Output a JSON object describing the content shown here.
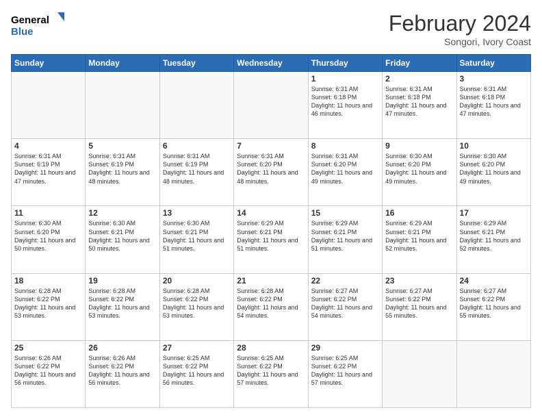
{
  "header": {
    "logo_line1": "General",
    "logo_line2": "Blue",
    "month_year": "February 2024",
    "location": "Songori, Ivory Coast"
  },
  "days_of_week": [
    "Sunday",
    "Monday",
    "Tuesday",
    "Wednesday",
    "Thursday",
    "Friday",
    "Saturday"
  ],
  "weeks": [
    [
      {
        "day": "",
        "info": ""
      },
      {
        "day": "",
        "info": ""
      },
      {
        "day": "",
        "info": ""
      },
      {
        "day": "",
        "info": ""
      },
      {
        "day": "1",
        "info": "Sunrise: 6:31 AM\nSunset: 6:18 PM\nDaylight: 11 hours and 46 minutes."
      },
      {
        "day": "2",
        "info": "Sunrise: 6:31 AM\nSunset: 6:18 PM\nDaylight: 11 hours and 47 minutes."
      },
      {
        "day": "3",
        "info": "Sunrise: 6:31 AM\nSunset: 6:18 PM\nDaylight: 11 hours and 47 minutes."
      }
    ],
    [
      {
        "day": "4",
        "info": "Sunrise: 6:31 AM\nSunset: 6:19 PM\nDaylight: 11 hours and 47 minutes."
      },
      {
        "day": "5",
        "info": "Sunrise: 6:31 AM\nSunset: 6:19 PM\nDaylight: 11 hours and 48 minutes."
      },
      {
        "day": "6",
        "info": "Sunrise: 6:31 AM\nSunset: 6:19 PM\nDaylight: 11 hours and 48 minutes."
      },
      {
        "day": "7",
        "info": "Sunrise: 6:31 AM\nSunset: 6:20 PM\nDaylight: 11 hours and 48 minutes."
      },
      {
        "day": "8",
        "info": "Sunrise: 6:31 AM\nSunset: 6:20 PM\nDaylight: 11 hours and 49 minutes."
      },
      {
        "day": "9",
        "info": "Sunrise: 6:30 AM\nSunset: 6:20 PM\nDaylight: 11 hours and 49 minutes."
      },
      {
        "day": "10",
        "info": "Sunrise: 6:30 AM\nSunset: 6:20 PM\nDaylight: 11 hours and 49 minutes."
      }
    ],
    [
      {
        "day": "11",
        "info": "Sunrise: 6:30 AM\nSunset: 6:20 PM\nDaylight: 11 hours and 50 minutes."
      },
      {
        "day": "12",
        "info": "Sunrise: 6:30 AM\nSunset: 6:21 PM\nDaylight: 11 hours and 50 minutes."
      },
      {
        "day": "13",
        "info": "Sunrise: 6:30 AM\nSunset: 6:21 PM\nDaylight: 11 hours and 51 minutes."
      },
      {
        "day": "14",
        "info": "Sunrise: 6:29 AM\nSunset: 6:21 PM\nDaylight: 11 hours and 51 minutes."
      },
      {
        "day": "15",
        "info": "Sunrise: 6:29 AM\nSunset: 6:21 PM\nDaylight: 11 hours and 51 minutes."
      },
      {
        "day": "16",
        "info": "Sunrise: 6:29 AM\nSunset: 6:21 PM\nDaylight: 11 hours and 52 minutes."
      },
      {
        "day": "17",
        "info": "Sunrise: 6:29 AM\nSunset: 6:21 PM\nDaylight: 11 hours and 52 minutes."
      }
    ],
    [
      {
        "day": "18",
        "info": "Sunrise: 6:28 AM\nSunset: 6:22 PM\nDaylight: 11 hours and 53 minutes."
      },
      {
        "day": "19",
        "info": "Sunrise: 6:28 AM\nSunset: 6:22 PM\nDaylight: 11 hours and 53 minutes."
      },
      {
        "day": "20",
        "info": "Sunrise: 6:28 AM\nSunset: 6:22 PM\nDaylight: 11 hours and 53 minutes."
      },
      {
        "day": "21",
        "info": "Sunrise: 6:28 AM\nSunset: 6:22 PM\nDaylight: 11 hours and 54 minutes."
      },
      {
        "day": "22",
        "info": "Sunrise: 6:27 AM\nSunset: 6:22 PM\nDaylight: 11 hours and 54 minutes."
      },
      {
        "day": "23",
        "info": "Sunrise: 6:27 AM\nSunset: 6:22 PM\nDaylight: 11 hours and 55 minutes."
      },
      {
        "day": "24",
        "info": "Sunrise: 6:27 AM\nSunset: 6:22 PM\nDaylight: 11 hours and 55 minutes."
      }
    ],
    [
      {
        "day": "25",
        "info": "Sunrise: 6:26 AM\nSunset: 6:22 PM\nDaylight: 11 hours and 56 minutes."
      },
      {
        "day": "26",
        "info": "Sunrise: 6:26 AM\nSunset: 6:22 PM\nDaylight: 11 hours and 56 minutes."
      },
      {
        "day": "27",
        "info": "Sunrise: 6:25 AM\nSunset: 6:22 PM\nDaylight: 11 hours and 56 minutes."
      },
      {
        "day": "28",
        "info": "Sunrise: 6:25 AM\nSunset: 6:22 PM\nDaylight: 11 hours and 57 minutes."
      },
      {
        "day": "29",
        "info": "Sunrise: 6:25 AM\nSunset: 6:22 PM\nDaylight: 11 hours and 57 minutes."
      },
      {
        "day": "",
        "info": ""
      },
      {
        "day": "",
        "info": ""
      }
    ]
  ]
}
